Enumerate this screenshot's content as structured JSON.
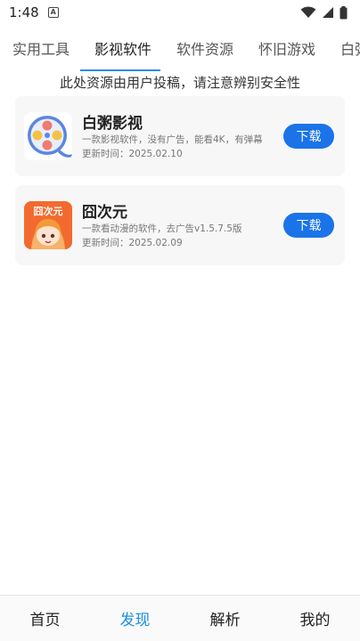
{
  "status_bar": {
    "time": "1:48",
    "notification_letter": "A"
  },
  "tabs": [
    {
      "label": "实用工具"
    },
    {
      "label": "影视软件"
    },
    {
      "label": "软件资源"
    },
    {
      "label": "怀旧游戏"
    },
    {
      "label": "白粥"
    }
  ],
  "active_tab": 1,
  "notice": "此处资源由用户投稿，请注意辨别安全性",
  "apps": [
    {
      "name": "白粥影视",
      "description": "一款影视软件，没有广告，能看4K，有弹幕",
      "updated": "更新时间：2025.02.10",
      "download_label": "下载"
    },
    {
      "name": "囧次元",
      "description": "一款看动漫的软件，去广告v1.5.7.5版",
      "updated": "更新时间：2025.02.09",
      "download_label": "下载",
      "icon_text": "囧次元"
    }
  ],
  "bottom_nav": [
    {
      "label": "首页"
    },
    {
      "label": "发现"
    },
    {
      "label": "解析"
    },
    {
      "label": "我的"
    }
  ],
  "colors": {
    "accent": "#1a73e8",
    "nav_active": "#1a8fe3",
    "indicator": "#2a8be8"
  }
}
